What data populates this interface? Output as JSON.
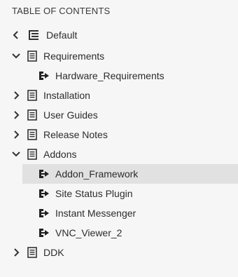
{
  "panel": {
    "title": "TABLE OF CONTENTS"
  },
  "items": [
    {
      "label": "Default",
      "icon": "outline-list-icon",
      "chevron": "left"
    },
    {
      "label": "Requirements",
      "icon": "document-icon",
      "chevron": "down"
    },
    {
      "label": "Hardware_Requirements",
      "icon": "topic-link-icon"
    },
    {
      "label": "Installation",
      "icon": "document-icon",
      "chevron": "right"
    },
    {
      "label": "User Guides",
      "icon": "document-icon",
      "chevron": "right"
    },
    {
      "label": "Release Notes",
      "icon": "document-icon",
      "chevron": "right"
    },
    {
      "label": "Addons",
      "icon": "document-icon",
      "chevron": "down"
    },
    {
      "label": "Addon_Framework",
      "icon": "topic-link-icon",
      "selected": true
    },
    {
      "label": "Site Status Plugin",
      "icon": "topic-link-icon"
    },
    {
      "label": "Instant Messenger",
      "icon": "topic-link-icon"
    },
    {
      "label": "VNC_Viewer_2",
      "icon": "topic-link-icon"
    },
    {
      "label": "DDK",
      "icon": "document-icon",
      "chevron": "right"
    }
  ],
  "colors": {
    "background": "#f6f6f6",
    "selected_row": "#e1e1e1",
    "text": "#2c2c2c"
  }
}
